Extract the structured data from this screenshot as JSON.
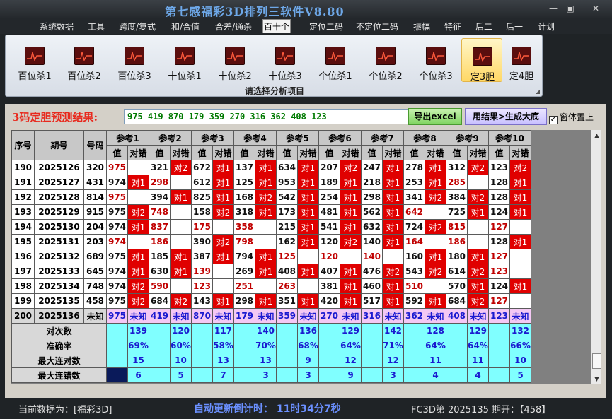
{
  "window": {
    "title": "第七感福彩3D排列三软件V8.80",
    "min": "—",
    "max": "▣",
    "close": "✕"
  },
  "menu": [
    "系统数据",
    "工具",
    "跨度/复式",
    "和/合值",
    "合差/通杀",
    "百十个",
    "定位二码",
    "不定位二码",
    "振幅",
    "特征",
    "后二",
    "后一",
    "计划"
  ],
  "menu_active": "百十个",
  "ribbon": {
    "buttons": [
      "百位杀1",
      "百位杀2",
      "百位杀3",
      "十位杀1",
      "十位杀2",
      "十位杀3",
      "个位杀1",
      "个位杀2",
      "个位杀3",
      "定3胆",
      "定4胆"
    ],
    "selected": "定3胆",
    "caption": "请选择分析项目",
    "icon": "chart-icon"
  },
  "prediction": {
    "label": "3码定胆预测结果:",
    "value": "975 419 870 179 359 270 316 362 408 123",
    "export_label": "导出excel",
    "gen_label": "用结果>生成大底",
    "ontop_label": "窗体置上",
    "ontop_checked": "✓"
  },
  "grid": {
    "headers": {
      "seq": "序号",
      "period": "期号",
      "number": "号码",
      "value": "值",
      "check": "对错"
    },
    "refs": [
      "参考1",
      "参考2",
      "参考3",
      "参考4",
      "参考5",
      "参考6",
      "参考7",
      "参考8",
      "参考9",
      "参考10"
    ],
    "rows": [
      {
        "seq": "190",
        "period": "2025126",
        "num": "320",
        "cells": [
          [
            "975",
            "",
            "red"
          ],
          [
            "321",
            "对2",
            "dark"
          ],
          [
            "672",
            "对1",
            "dark"
          ],
          [
            "137",
            "对1",
            "dark"
          ],
          [
            "634",
            "对1",
            "dark"
          ],
          [
            "207",
            "对2",
            "dark"
          ],
          [
            "247",
            "对1",
            "dark"
          ],
          [
            "278",
            "对1",
            "dark"
          ],
          [
            "312",
            "对2",
            "dark"
          ],
          [
            "123",
            "对2",
            "dark"
          ]
        ]
      },
      {
        "seq": "191",
        "period": "2025127",
        "num": "431",
        "cells": [
          [
            "974",
            "对1",
            "dark"
          ],
          [
            "298",
            "",
            "red"
          ],
          [
            "612",
            "对1",
            "dark"
          ],
          [
            "125",
            "对1",
            "dark"
          ],
          [
            "953",
            "对1",
            "dark"
          ],
          [
            "189",
            "对1",
            "dark"
          ],
          [
            "218",
            "对1",
            "dark"
          ],
          [
            "253",
            "对1",
            "dark"
          ],
          [
            "285",
            "",
            "red"
          ],
          [
            "128",
            "对1",
            "dark"
          ]
        ]
      },
      {
        "seq": "192",
        "period": "2025128",
        "num": "814",
        "cells": [
          [
            "975",
            "",
            "red"
          ],
          [
            "394",
            "对1",
            "dark"
          ],
          [
            "825",
            "对1",
            "dark"
          ],
          [
            "168",
            "对2",
            "dark"
          ],
          [
            "542",
            "对1",
            "dark"
          ],
          [
            "254",
            "对1",
            "dark"
          ],
          [
            "298",
            "对1",
            "dark"
          ],
          [
            "341",
            "对2",
            "dark"
          ],
          [
            "384",
            "对2",
            "dark"
          ],
          [
            "128",
            "对1",
            "dark"
          ]
        ]
      },
      {
        "seq": "193",
        "period": "2025129",
        "num": "915",
        "cells": [
          [
            "975",
            "对2",
            "dark"
          ],
          [
            "748",
            "",
            "red"
          ],
          [
            "158",
            "对2",
            "dark"
          ],
          [
            "318",
            "对1",
            "dark"
          ],
          [
            "173",
            "对1",
            "dark"
          ],
          [
            "481",
            "对1",
            "dark"
          ],
          [
            "562",
            "对1",
            "dark"
          ],
          [
            "642",
            "",
            "red"
          ],
          [
            "725",
            "对1",
            "dark"
          ],
          [
            "124",
            "对1",
            "dark"
          ]
        ]
      },
      {
        "seq": "194",
        "period": "2025130",
        "num": "204",
        "cells": [
          [
            "974",
            "对1",
            "dark"
          ],
          [
            "837",
            "",
            "red"
          ],
          [
            "175",
            "",
            "red"
          ],
          [
            "358",
            "",
            "red"
          ],
          [
            "215",
            "对1",
            "dark"
          ],
          [
            "541",
            "对1",
            "dark"
          ],
          [
            "632",
            "对1",
            "dark"
          ],
          [
            "724",
            "对2",
            "dark"
          ],
          [
            "815",
            "",
            "red"
          ],
          [
            "127",
            "",
            "red"
          ]
        ]
      },
      {
        "seq": "195",
        "period": "2025131",
        "num": "203",
        "cells": [
          [
            "974",
            "",
            "red"
          ],
          [
            "186",
            "",
            "red"
          ],
          [
            "390",
            "对2",
            "dark"
          ],
          [
            "798",
            "",
            "red"
          ],
          [
            "162",
            "对1",
            "dark"
          ],
          [
            "120",
            "对2",
            "dark"
          ],
          [
            "140",
            "对1",
            "dark"
          ],
          [
            "164",
            "",
            "red"
          ],
          [
            "186",
            "",
            "red"
          ],
          [
            "128",
            "对1",
            "dark"
          ]
        ]
      },
      {
        "seq": "196",
        "period": "2025132",
        "num": "689",
        "cells": [
          [
            "975",
            "对1",
            "dark"
          ],
          [
            "185",
            "对1",
            "dark"
          ],
          [
            "387",
            "对1",
            "dark"
          ],
          [
            "794",
            "对1",
            "dark"
          ],
          [
            "125",
            "",
            "red"
          ],
          [
            "120",
            "",
            "red"
          ],
          [
            "140",
            "",
            "red"
          ],
          [
            "160",
            "对1",
            "dark"
          ],
          [
            "180",
            "对1",
            "dark"
          ],
          [
            "127",
            "",
            "red"
          ]
        ]
      },
      {
        "seq": "197",
        "period": "2025133",
        "num": "645",
        "cells": [
          [
            "974",
            "对1",
            "dark"
          ],
          [
            "630",
            "对1",
            "dark"
          ],
          [
            "139",
            "",
            "red"
          ],
          [
            "269",
            "对1",
            "dark"
          ],
          [
            "408",
            "对1",
            "dark"
          ],
          [
            "407",
            "对1",
            "dark"
          ],
          [
            "476",
            "对2",
            "dark"
          ],
          [
            "543",
            "对2",
            "dark"
          ],
          [
            "614",
            "对2",
            "dark"
          ],
          [
            "123",
            "",
            "red"
          ]
        ]
      },
      {
        "seq": "198",
        "period": "2025134",
        "num": "748",
        "cells": [
          [
            "974",
            "对2",
            "dark"
          ],
          [
            "590",
            "",
            "red"
          ],
          [
            "123",
            "",
            "red"
          ],
          [
            "251",
            "",
            "red"
          ],
          [
            "263",
            "",
            "red"
          ],
          [
            "381",
            "对1",
            "dark"
          ],
          [
            "460",
            "对1",
            "dark"
          ],
          [
            "510",
            "",
            "red"
          ],
          [
            "570",
            "对1",
            "dark"
          ],
          [
            "124",
            "对1",
            "dark"
          ]
        ]
      },
      {
        "seq": "199",
        "period": "2025135",
        "num": "458",
        "cells": [
          [
            "975",
            "对2",
            "dark"
          ],
          [
            "684",
            "对2",
            "dark"
          ],
          [
            "143",
            "对1",
            "dark"
          ],
          [
            "298",
            "对1",
            "dark"
          ],
          [
            "351",
            "对1",
            "dark"
          ],
          [
            "420",
            "对1",
            "dark"
          ],
          [
            "517",
            "对1",
            "dark"
          ],
          [
            "592",
            "对1",
            "dark"
          ],
          [
            "684",
            "对2",
            "dark"
          ],
          [
            "127",
            "",
            "red"
          ]
        ]
      }
    ],
    "future": {
      "seq": "200",
      "period": "2025136",
      "num": "未知",
      "values": [
        "975",
        "419",
        "870",
        "179",
        "359",
        "270",
        "316",
        "362",
        "408",
        "123"
      ],
      "check": "未知"
    },
    "stats": [
      {
        "label": "对次数",
        "values": [
          "139",
          "120",
          "117",
          "140",
          "136",
          "129",
          "142",
          "128",
          "129",
          "132"
        ]
      },
      {
        "label": "准确率",
        "values": [
          "69%",
          "60%",
          "58%",
          "70%",
          "68%",
          "64%",
          "71%",
          "64%",
          "64%",
          "66%"
        ]
      },
      {
        "label": "最大连对数",
        "values": [
          "15",
          "10",
          "13",
          "13",
          "9",
          "12",
          "12",
          "11",
          "11",
          "10"
        ]
      },
      {
        "label": "最大连错数",
        "values": [
          "6",
          "5",
          "7",
          "3",
          "3",
          "9",
          "3",
          "4",
          "4",
          "5"
        ]
      }
    ]
  },
  "scroll": {
    "up": "▲",
    "down": "▼"
  },
  "status": {
    "data_source": "当前数据为：[福彩3D]",
    "countdown": "自动更新倒计时：  11时34分7秒",
    "period_info": "FC3D第 2025135 期开：【458】"
  }
}
